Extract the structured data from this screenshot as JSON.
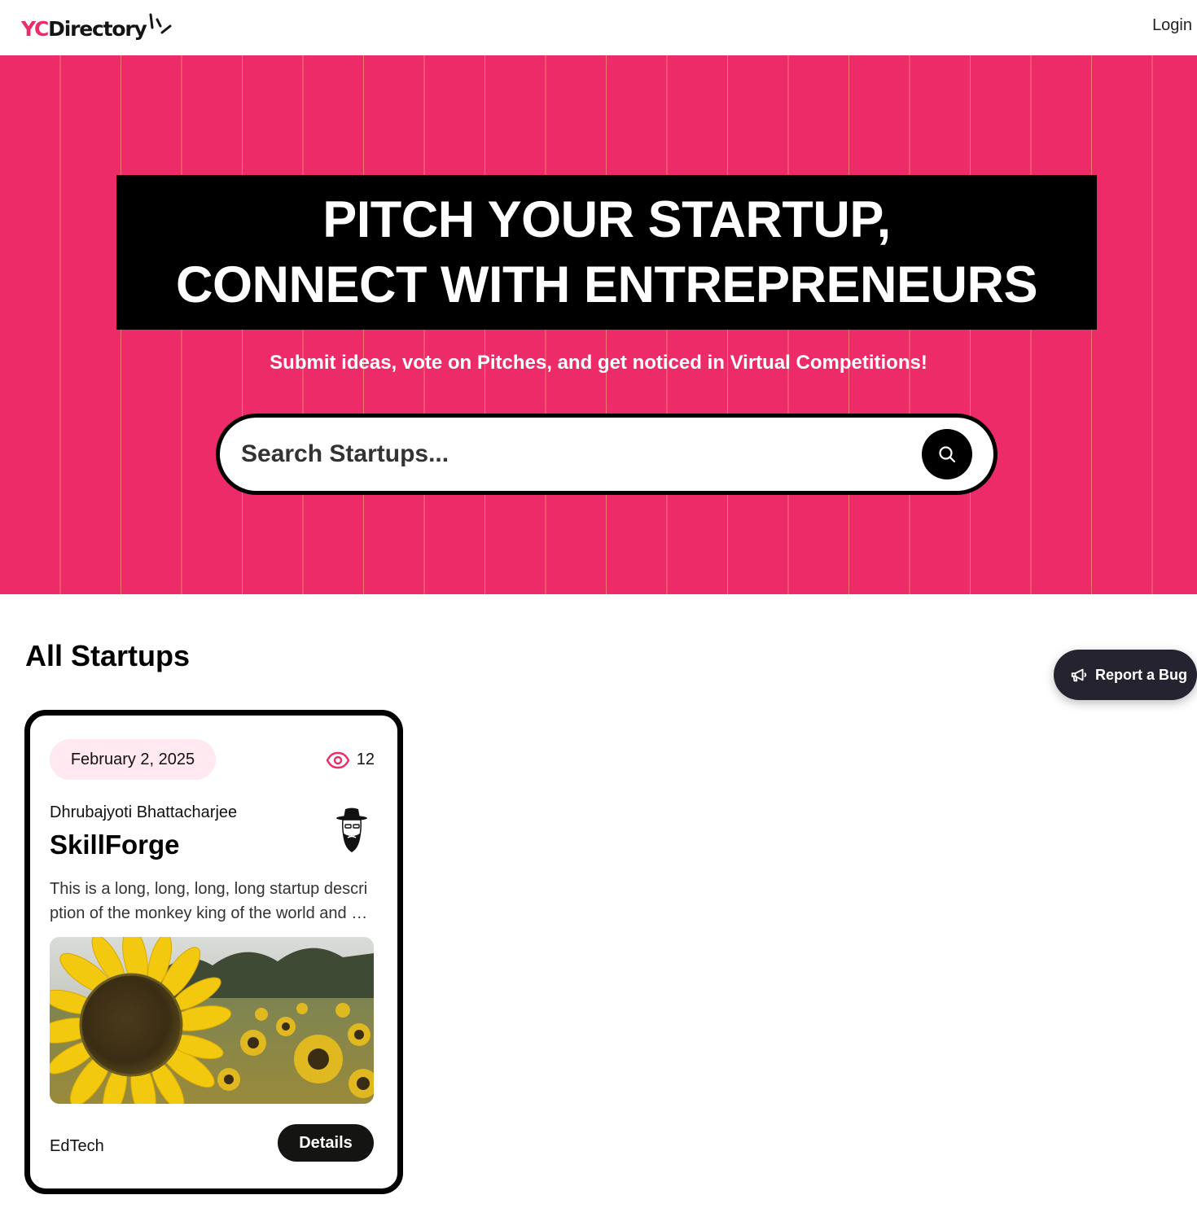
{
  "navbar": {
    "logo_yc": "YC",
    "logo_directory": "Directory",
    "login_label": "Login"
  },
  "hero": {
    "heading_line1": "Pitch Your Startup,",
    "heading_line2": "Connect With Entrepreneurs",
    "subheading": "Submit ideas, vote on Pitches, and get noticed in Virtual Competitions!",
    "search_placeholder": "Search Startups...",
    "background_color": "#EE2B69"
  },
  "section": {
    "title": "All Startups"
  },
  "startups": [
    {
      "date": "February 2, 2025",
      "views": "12",
      "author": "Dhrubajyoti Bhattacharjee",
      "title": "SkillForge",
      "description": "This is a long, long, long, long startup description of the monkey king of the world and beyond, bigger than anything you have ever seen before.",
      "category": "EdTech",
      "details_label": "Details",
      "image": "sunflower-field"
    }
  ],
  "report_bug": {
    "label": "Report a Bug",
    "icon": "megaphone-icon"
  },
  "colors": {
    "accent": "#EE2B69",
    "dark": "#141413",
    "pill": "#FFE8F0"
  }
}
